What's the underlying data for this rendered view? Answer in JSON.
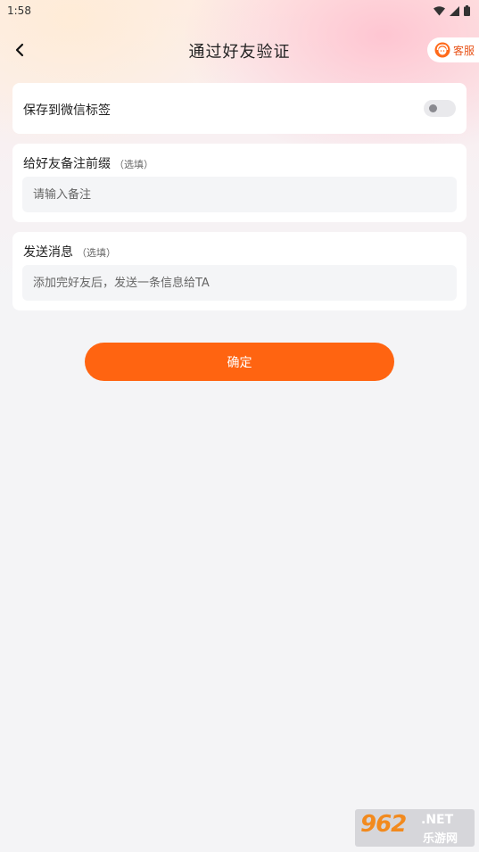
{
  "status_bar": {
    "time": "1:58"
  },
  "nav": {
    "title": "通过好友验证",
    "service_label": "客服"
  },
  "save_tag": {
    "label": "保存到微信标签",
    "toggle_on": false
  },
  "remark": {
    "label": "给好友备注前缀",
    "optional": "（选填）",
    "placeholder": "请输入备注",
    "value": ""
  },
  "message": {
    "label": "发送消息",
    "optional": "（选填）",
    "placeholder": "添加完好友后，发送一条信息给TA",
    "value": ""
  },
  "confirm_label": "确定",
  "watermark": {
    "number": "962",
    "suffix": ".NET",
    "text": "乐游网"
  },
  "colors": {
    "accent": "#ff6411",
    "background": "#f4f4f6",
    "card": "#ffffff"
  }
}
